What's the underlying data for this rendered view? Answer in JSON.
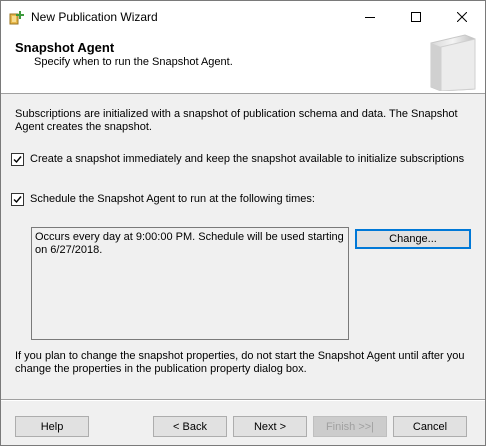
{
  "window": {
    "title": "New Publication Wizard"
  },
  "header": {
    "title": "Snapshot Agent",
    "subtitle": "Specify when to run the Snapshot Agent."
  },
  "content": {
    "description": "Subscriptions are initialized with a snapshot of publication schema and data. The Snapshot Agent creates the snapshot.",
    "create_snapshot_checkbox": {
      "label": "Create a snapshot immediately and keep the snapshot available to initialize subscriptions",
      "checked": true
    },
    "schedule_checkbox": {
      "label": "Schedule the Snapshot Agent to run at the following times:",
      "checked": true
    },
    "schedule_description": "Occurs every day at 9:00:00 PM. Schedule will be used starting on 6/27/2018.",
    "change_button": "Change...",
    "note": "If you plan to change the snapshot properties, do not start the Snapshot Agent until after you change the properties in the publication property dialog box."
  },
  "footer": {
    "help": "Help",
    "back": "< Back",
    "next": "Next >",
    "finish": "Finish >>|",
    "cancel": "Cancel"
  },
  "icons": {
    "app": "wizard-app-icon",
    "header": "book-graphic-icon",
    "minimize": "minimize-icon",
    "maximize": "maximize-icon",
    "close": "close-icon",
    "check": "check-icon"
  },
  "colors": {
    "dialog_background": "#f0f0f0",
    "header_background": "#ffffff",
    "focus_border": "#0078d7",
    "disabled_text": "#a0a0a0"
  }
}
